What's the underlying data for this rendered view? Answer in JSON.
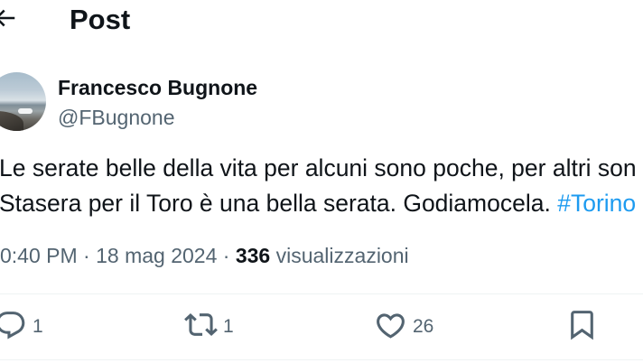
{
  "header": {
    "title": "Post",
    "back_icon": "arrow-left-icon"
  },
  "author": {
    "name": "Francesco Bugnone",
    "handle": "@FBugnone"
  },
  "tweet": {
    "line1": "Le serate belle della vita per alcuni sono poche, per altri son",
    "line2": "Stasera per il Toro è una bella serata. Godiamocela.",
    "hashtag": "#Torino"
  },
  "meta": {
    "time": "0:40 PM",
    "separator": "·",
    "date": "18 mag 2024",
    "views_count": "336",
    "views_label": "visualizzazioni"
  },
  "actions": {
    "reply": {
      "icon": "reply-icon",
      "count": "1"
    },
    "repost": {
      "icon": "retweet-icon",
      "count": "1"
    },
    "like": {
      "icon": "heart-icon",
      "count": "26"
    },
    "bookmark": {
      "icon": "bookmark-icon"
    }
  },
  "colors": {
    "text": "#0f1419",
    "secondary": "#536471",
    "link": "#1d9bf0",
    "divider": "#eff3f4"
  }
}
